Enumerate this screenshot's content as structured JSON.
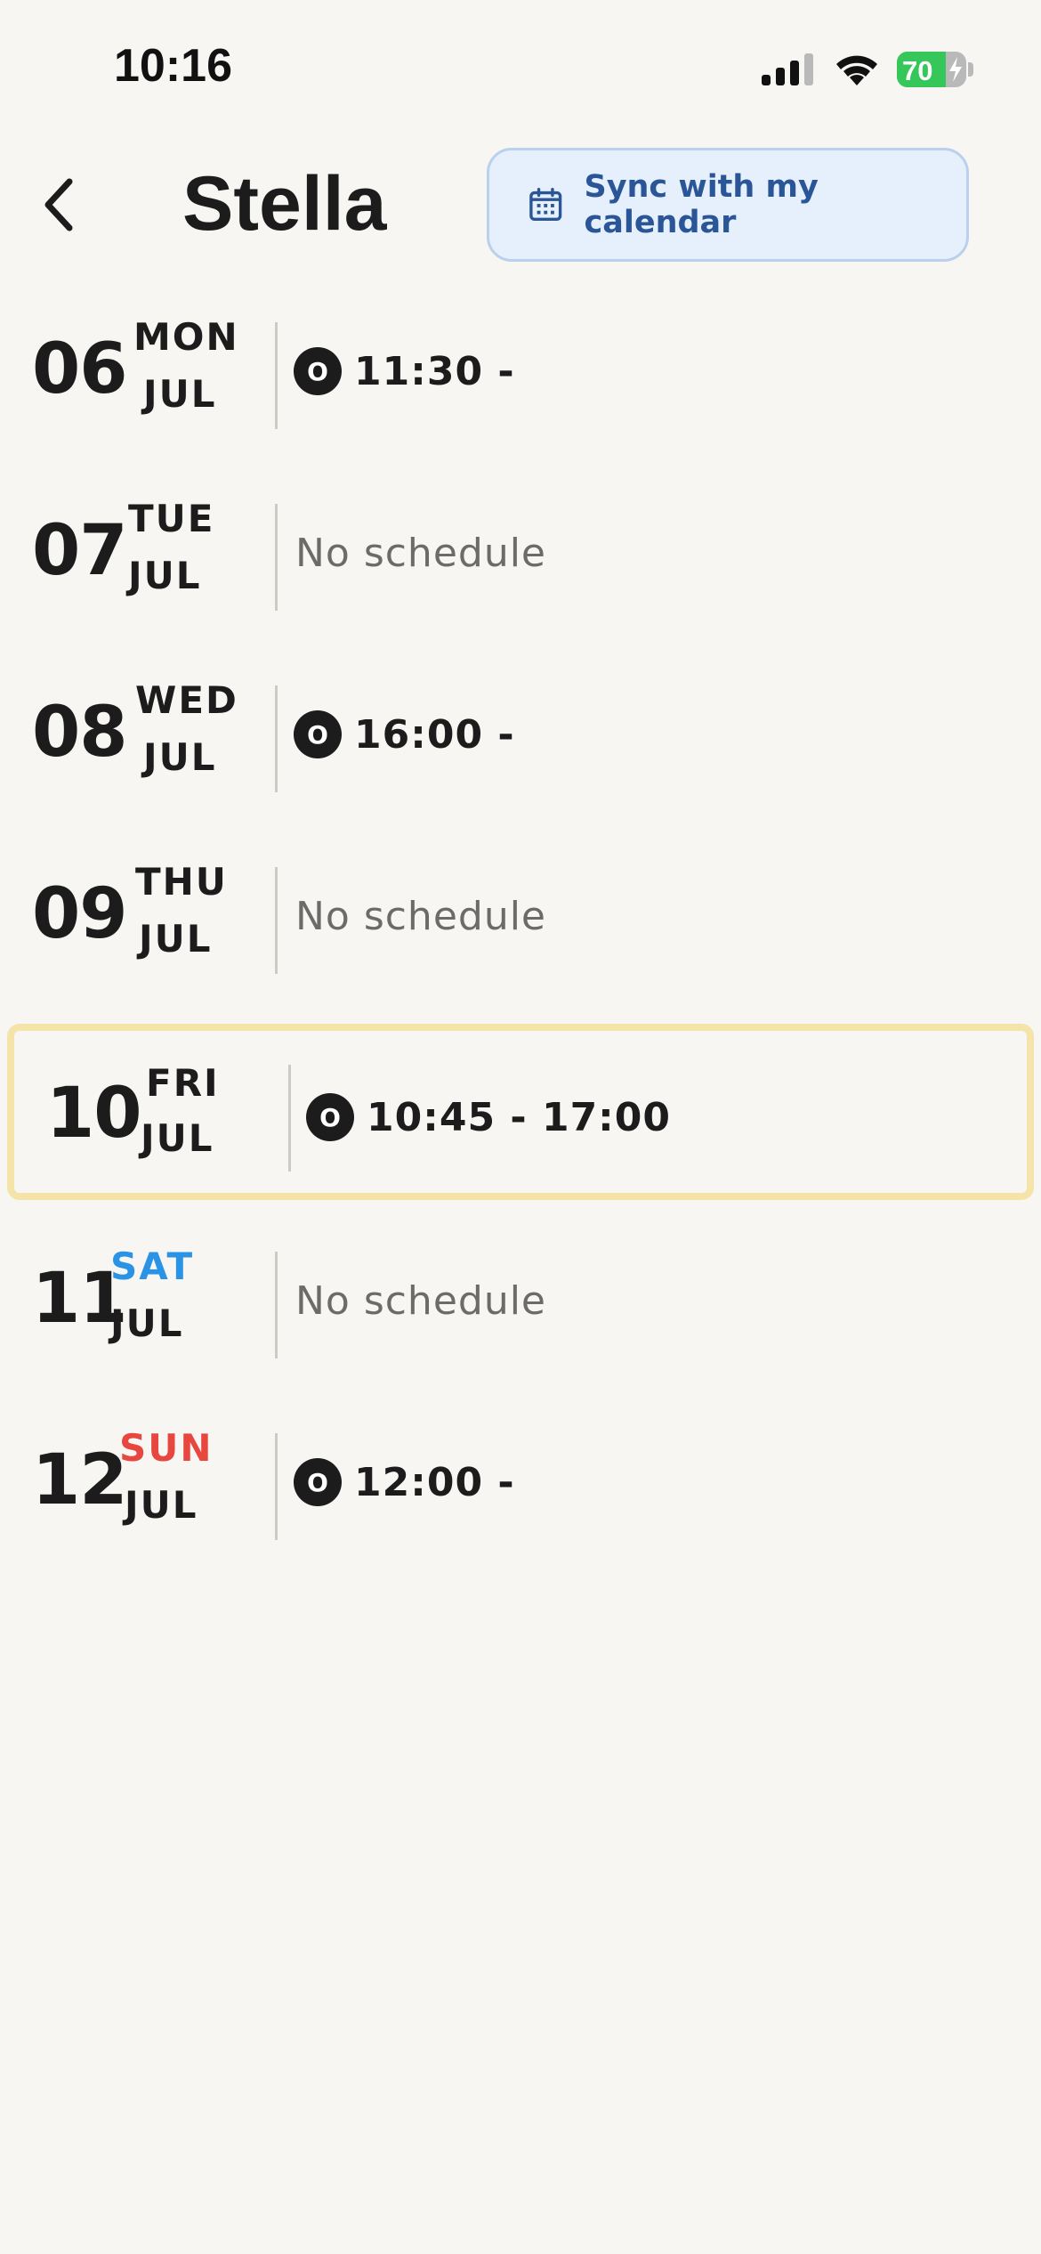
{
  "status_bar": {
    "time": "10:16",
    "battery_level": 70,
    "battery_text": "70",
    "battery_color": "#35c759",
    "icons": [
      "signal-icon",
      "wifi-icon",
      "battery-icon"
    ]
  },
  "header": {
    "back_icon": "chevron-left-icon",
    "title": "Stella",
    "sync_icon": "calendar-icon",
    "sync_label": "Sync with my calendar"
  },
  "colors": {
    "saturday": "#2b93e6",
    "sunday": "#e8473f",
    "today_border": "#f5e4a9",
    "sync_bg": "#e6f0fc",
    "sync_text": "#2a5597"
  },
  "days": [
    {
      "day": "06",
      "dow": "MON",
      "month": "JUL",
      "has_schedule": true,
      "badge": "O",
      "time": "11:30 -",
      "no_schedule": ""
    },
    {
      "day": "07",
      "dow": "TUE",
      "month": "JUL",
      "has_schedule": false,
      "badge": "",
      "time": "",
      "no_schedule": "No schedule"
    },
    {
      "day": "08",
      "dow": "WED",
      "month": "JUL",
      "has_schedule": true,
      "badge": "O",
      "time": "16:00 -",
      "no_schedule": ""
    },
    {
      "day": "09",
      "dow": "THU",
      "month": "JUL",
      "has_schedule": false,
      "badge": "",
      "time": "",
      "no_schedule": "No schedule"
    },
    {
      "day": "10",
      "dow": "FRI",
      "month": "JUL",
      "has_schedule": true,
      "badge": "O",
      "time": "10:45 - 17:00",
      "no_schedule": "",
      "today": true
    },
    {
      "day": "11",
      "dow": "SAT",
      "month": "JUL",
      "has_schedule": false,
      "badge": "",
      "time": "",
      "no_schedule": "No schedule"
    },
    {
      "day": "12",
      "dow": "SUN",
      "month": "JUL",
      "has_schedule": true,
      "badge": "O",
      "time": "12:00 -",
      "no_schedule": ""
    }
  ]
}
